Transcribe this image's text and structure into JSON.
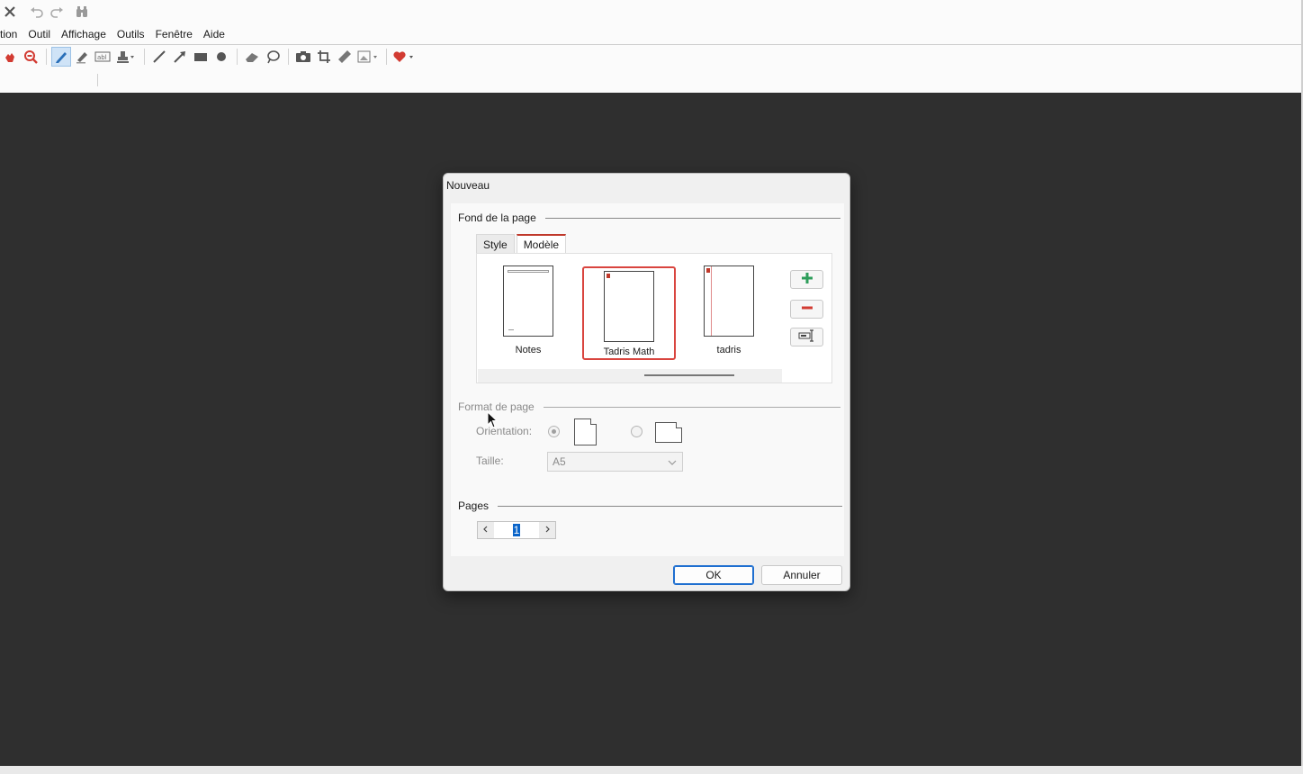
{
  "menubar": {
    "items": [
      "tion",
      "Outil",
      "Affichage",
      "Outils",
      "Fenêtre",
      "Aide"
    ]
  },
  "quick_access": {
    "icons": [
      "close-icon",
      "undo-icon",
      "redo-icon",
      "binoculars-icon"
    ]
  },
  "toolbar": {
    "icons": [
      "hand-icon",
      "zoom-out-icon",
      "pen-icon",
      "highlighter-icon",
      "text-box-icon",
      "stamp-icon",
      "line-icon",
      "arrow-icon",
      "rectangle-icon",
      "circle-icon",
      "eraser-icon",
      "lasso-icon",
      "camera-icon",
      "crop-icon",
      "ruler-icon",
      "image-icon",
      "heart-icon"
    ]
  },
  "dialog": {
    "title": "Nouveau",
    "section_background": "Fond de la page",
    "tabs": [
      "Style",
      "Modèle"
    ],
    "selected_tab": "Modèle",
    "templates": [
      {
        "name": "Notes",
        "selected": false
      },
      {
        "name": "Tadris Math",
        "selected": true
      },
      {
        "name": "tadris",
        "selected": false
      }
    ],
    "side_buttons": [
      "add-template-icon",
      "remove-template-icon",
      "rename-template-icon"
    ],
    "section_format": "Format de page",
    "orientation_label": "Orientation:",
    "orientation_selected": "portrait",
    "size_label": "Taille:",
    "size_value": "A5",
    "section_pages": "Pages",
    "pages_value": "1",
    "ok_label": "OK",
    "cancel_label": "Annuler"
  },
  "colors": {
    "workspace": "#2f2f2f",
    "selection_border": "#d9453f",
    "ok_border": "#1f6fd0",
    "add_green": "#2e9e5b",
    "remove_red": "#d23b32"
  }
}
